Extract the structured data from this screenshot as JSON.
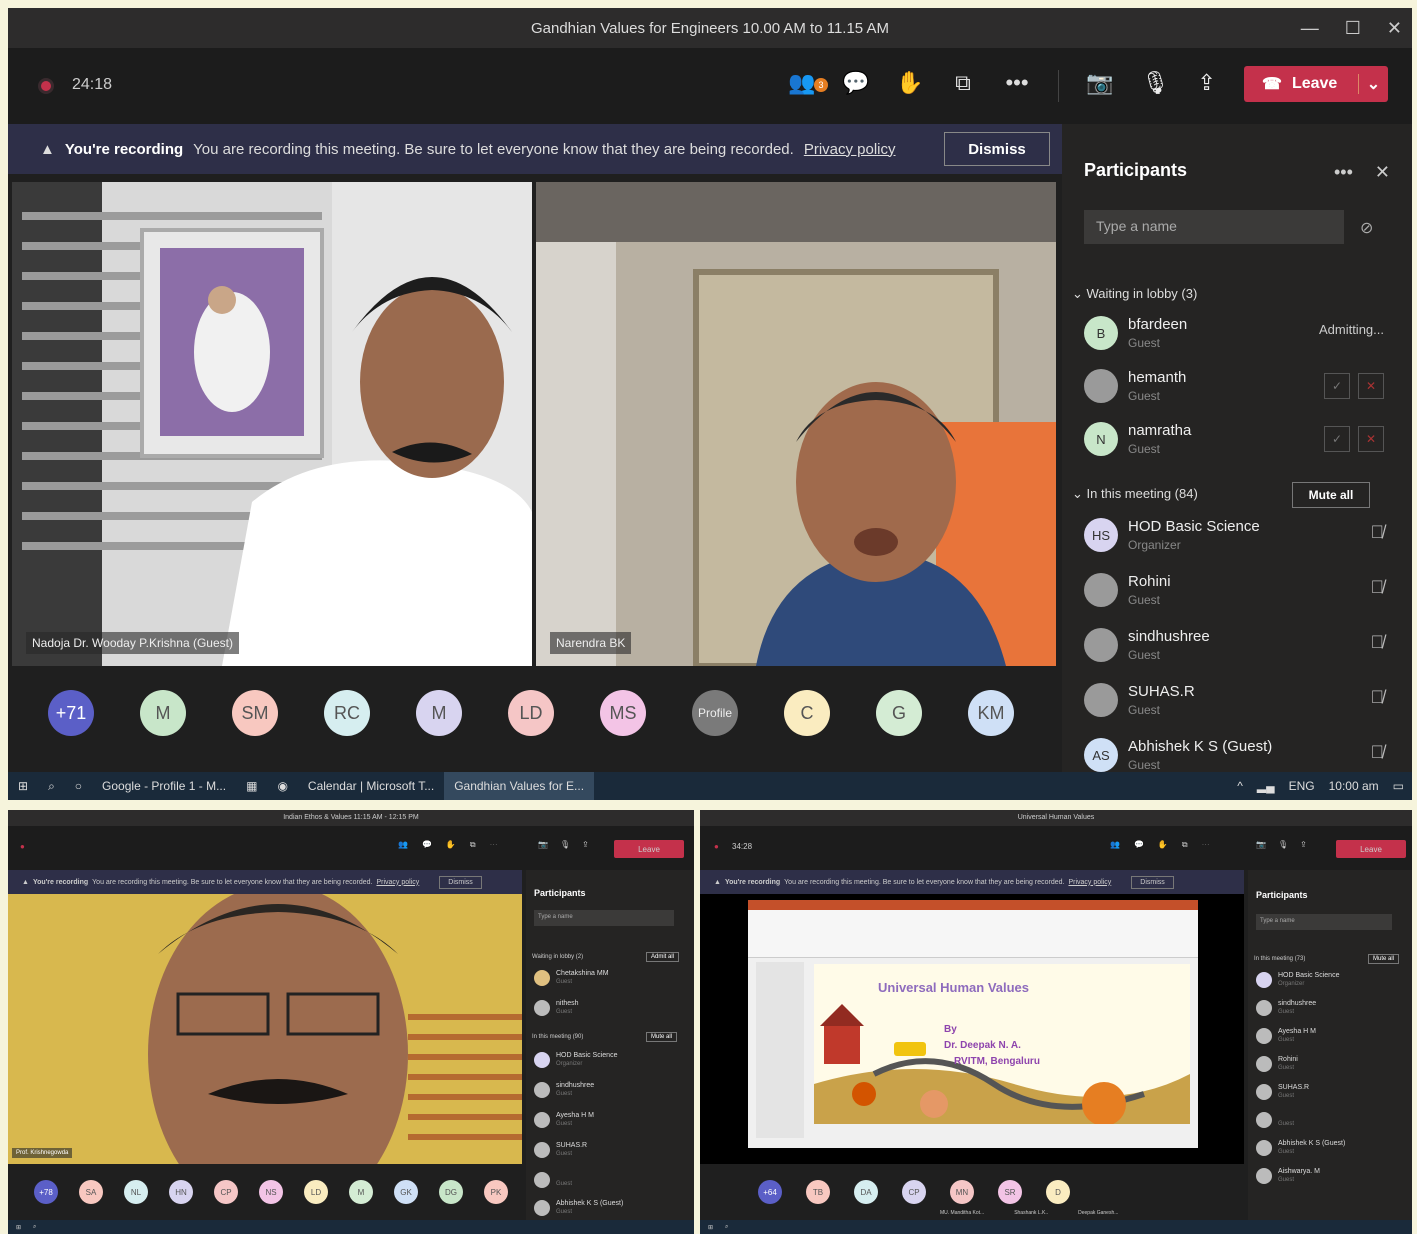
{
  "main": {
    "window_title": "Gandhian Values for Engineers 10.00 AM to 11.15 AM",
    "window_controls": [
      "—",
      "☐",
      "✕"
    ],
    "timer": "24:18",
    "toolbar_badge": "3",
    "leave_label": "Leave",
    "banner": {
      "title": "You're recording",
      "text": "You are recording this meeting. Be sure to let everyone know that they are being recorded.",
      "link": "Privacy policy",
      "dismiss": "Dismiss"
    },
    "tiles": [
      {
        "label": "Nadoja Dr. Wooday P.Krishna (Guest)"
      },
      {
        "label": "Narendra BK"
      }
    ],
    "avatars": [
      {
        "initials": "+71",
        "color": "#5b5fc7",
        "text_color": "#ffffff"
      },
      {
        "initials": "M",
        "color": "#c8e6c9"
      },
      {
        "initials": "SM",
        "color": "#f8c8c0"
      },
      {
        "initials": "RC",
        "color": "#d6eef0"
      },
      {
        "initials": "M",
        "color": "#d8d4f0"
      },
      {
        "initials": "LD",
        "color": "#f5c6c6"
      },
      {
        "initials": "MS",
        "color": "#f3c4e6"
      },
      {
        "initials": "Profile",
        "color": "#7a7a7a",
        "text_color": "#eeeeee"
      },
      {
        "initials": "C",
        "color": "#faecc0"
      },
      {
        "initials": "G",
        "color": "#d4ecd4"
      },
      {
        "initials": "KM",
        "color": "#cfe0f6"
      }
    ],
    "participants": {
      "title": "Participants",
      "search_placeholder": "Type a name",
      "lobby_header": "Waiting in lobby (3)",
      "lobby": [
        {
          "initials": "B",
          "name": "bfardeen",
          "role": "Guest",
          "status": "Admitting..."
        },
        {
          "initials": "",
          "name": "hemanth",
          "role": "Guest"
        },
        {
          "initials": "N",
          "name": "namratha",
          "role": "Guest"
        }
      ],
      "meeting_header": "In this meeting (84)",
      "mute_all": "Mute all",
      "meeting": [
        {
          "initials": "HS",
          "name": "HOD Basic Science",
          "role": "Organizer"
        },
        {
          "initials": "",
          "name": "Rohini",
          "role": "Guest"
        },
        {
          "initials": "",
          "name": "sindhushree",
          "role": "Guest"
        },
        {
          "initials": "",
          "name": "SUHAS.R",
          "role": "Guest"
        },
        {
          "initials": "AS",
          "name": "Abhishek K S (Guest)",
          "role": "Guest"
        }
      ]
    },
    "taskbar": {
      "items": [
        "Google - Profile 1 - M...",
        "Calendar | Microsoft T...",
        "Gandhian Values for E..."
      ],
      "lang": "ENG",
      "clock": "10:00 am"
    }
  },
  "bottom_left": {
    "window_title": "Indian Ethos & Values 11:15 AM - 12:15 PM",
    "leave_label": "Leave",
    "banner_title": "You're recording",
    "banner_text": "You are recording this meeting. Be sure to let everyone know that they are being recorded.",
    "banner_link": "Privacy policy",
    "dismiss": "Dismiss",
    "participants_title": "Participants",
    "search_placeholder": "Type a name",
    "lobby_header": "Waiting in lobby (2)",
    "admit_all": "Admit all",
    "lobby": [
      {
        "name": "Chetakshina MM",
        "role": "Guest"
      },
      {
        "name": "nithesh",
        "role": "Guest"
      }
    ],
    "meeting_header": "In this meeting (90)",
    "mute_all": "Mute all",
    "meeting": [
      {
        "name": "HOD Basic Science",
        "role": "Organizer"
      },
      {
        "name": "sindhushree",
        "role": "Guest"
      },
      {
        "name": "Ayesha H M",
        "role": "Guest"
      },
      {
        "name": "SUHAS.R",
        "role": "Guest"
      },
      {
        "name": "",
        "role": "Guest"
      },
      {
        "name": "Abhishek K S (Guest)",
        "role": "Guest"
      }
    ],
    "tile_label": "Prof. Krishnegowda",
    "avatars": [
      "+78",
      "SA",
      "NL",
      "HN",
      "CP",
      "NS",
      "LD",
      "M",
      "GK",
      "DG",
      "PK"
    ]
  },
  "bottom_right": {
    "window_title": "Universal Human Values",
    "timer": "34:28",
    "leave_label": "Leave",
    "banner_title": "You're recording",
    "banner_text": "You are recording this meeting. Be sure to let everyone know that they are being recorded.",
    "banner_link": "Privacy policy",
    "dismiss": "Dismiss",
    "participants_title": "Participants",
    "search_placeholder": "Type a name",
    "meeting_header": "In this meeting (73)",
    "mute_all": "Mute all",
    "meeting": [
      {
        "name": "HOD Basic Science",
        "role": "Organizer"
      },
      {
        "name": "sindhushree",
        "role": "Guest"
      },
      {
        "name": "Ayesha H M",
        "role": "Guest"
      },
      {
        "name": "Rohini",
        "role": "Guest"
      },
      {
        "name": "SUHAS.R",
        "role": "Guest"
      },
      {
        "name": "",
        "role": "Guest"
      },
      {
        "name": "Abhishek K S (Guest)",
        "role": "Guest"
      },
      {
        "name": "Aishwarya. M",
        "role": "Guest"
      }
    ],
    "slide": {
      "title": "Universal Human Values",
      "by": "By",
      "author": "Dr. Deepak N. A.",
      "org": "RVITM, Bengaluru"
    },
    "avatars": [
      "+64",
      "TB",
      "DA",
      "CP",
      "MN",
      "SR",
      "D"
    ],
    "avatar_labels": [
      "MU. Manditha Kot...",
      "Shashank L.K..",
      "Deepak Ganesh..."
    ]
  }
}
